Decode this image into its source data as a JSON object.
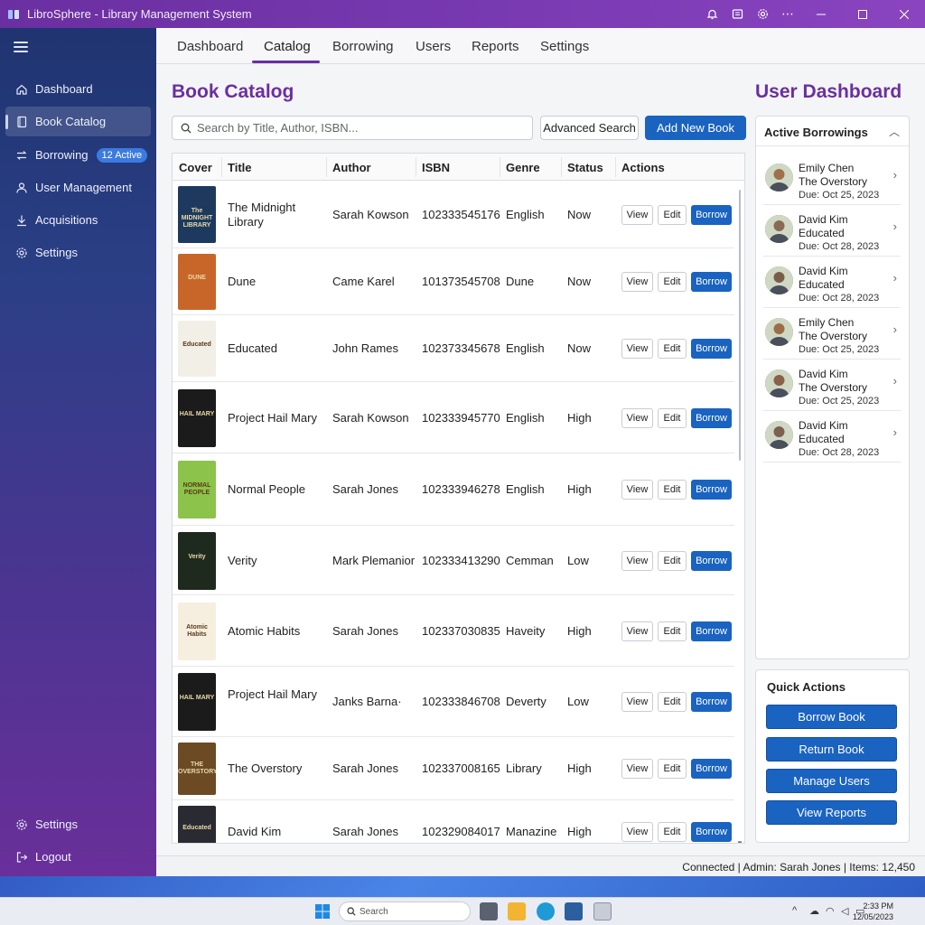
{
  "window": {
    "title": "LibroSphere - Library Management System",
    "status_bar": "Connected | Admin: Sarah Jones | Items: 12,450"
  },
  "sidebar": {
    "items": [
      {
        "label": "Dashboard",
        "icon": "home-icon"
      },
      {
        "label": "Book Catalog",
        "icon": "book-icon",
        "active": true
      },
      {
        "label": "Borrowing",
        "icon": "swap-icon",
        "badge": "12 Active"
      },
      {
        "label": "User Management",
        "icon": "users-icon"
      },
      {
        "label": "Acquisitions",
        "icon": "download-icon"
      },
      {
        "label": "Settings",
        "icon": "gear-icon"
      }
    ],
    "bottom": [
      {
        "label": "Settings",
        "icon": "gear-icon"
      },
      {
        "label": "Logout",
        "icon": "logout-icon"
      }
    ]
  },
  "tabs": [
    "Dashboard",
    "Catalog",
    "Borrowing",
    "Users",
    "Reports",
    "Settings"
  ],
  "active_tab": "Catalog",
  "catalog": {
    "title": "Book Catalog",
    "search_placeholder": "Search by Title, Author, ISBN...",
    "advanced_search": "Advanced Search",
    "add_new": "Add New Book",
    "columns": [
      "Cover",
      "Title",
      "Author",
      "ISBN",
      "Genre",
      "Status",
      "Actions"
    ],
    "view_label": "View",
    "edit_label": "Edit",
    "borrow_label": "Borrow",
    "rows": [
      {
        "title": "The Midnight Library",
        "author": "Sarah Kowson",
        "isbn": "102333545176",
        "genre": "English",
        "status": "Now",
        "cover_text": "The MIDNIGHT LIBRARY",
        "cover_bg": "#1d3a5e"
      },
      {
        "title": "Dune",
        "author": "Came Karel",
        "isbn": "101373545708",
        "genre": "Dune",
        "status": "Now",
        "cover_text": "DUNE",
        "cover_bg": "#c8662a"
      },
      {
        "title": "Educated",
        "author": "John Rames",
        "isbn": "102373345678",
        "genre": "English",
        "status": "Now",
        "cover_text": "Educated",
        "cover_bg": "#f2efe6"
      },
      {
        "title": "Project Hail Mary",
        "author": "Sarah Kowson",
        "isbn": "102333945770",
        "genre": "English",
        "status": "High",
        "cover_text": "HAIL MARY",
        "cover_bg": "#1b1b1b"
      },
      {
        "title": "Normal People",
        "author": "Sarah Jones",
        "isbn": "102333946278",
        "genre": "English",
        "status": "High",
        "cover_text": "NORMAL PEOPLE",
        "cover_bg": "#8cc34a"
      },
      {
        "title": "Verity",
        "author": "Mark Plemanior",
        "isbn": "102333413290",
        "genre": "Cemman",
        "status": "Low",
        "cover_text": "Verity",
        "cover_bg": "#1f2a1f"
      },
      {
        "title": "Atomic Habits",
        "author": "Sarah Jones",
        "isbn": "102337030835",
        "genre": "Haveity",
        "status": "High",
        "cover_text": "Atomic Habits",
        "cover_bg": "#f6efe0"
      },
      {
        "title": "Project Hail Mary",
        "author": "Janks Barna·",
        "isbn": "102333846708",
        "genre": "Deverty",
        "status": "Low",
        "cover_text": "HAIL MARY",
        "cover_bg": "#1b1b1b"
      },
      {
        "title": "The Overstory",
        "author": "Sarah Jones",
        "isbn": "102337008165",
        "genre": "Library",
        "status": "High",
        "cover_text": "THE OVERSTORY",
        "cover_bg": "#6b4a24"
      },
      {
        "title": "David Kim",
        "author": "Sarah Jones",
        "isbn": "102329084017",
        "genre": "Manazine",
        "status": "High",
        "cover_text": "Educated",
        "cover_bg": "#2a2a33"
      }
    ]
  },
  "user_dashboard": {
    "title": "User Dashboard",
    "active_borrowings_title": "Active Borrowings",
    "borrowings": [
      {
        "name": "Emily Chen",
        "book": "The Overstory",
        "due": "Due: Oct 25, 2023",
        "avatar_color": "#a0704a"
      },
      {
        "name": "David Kim",
        "book": "Educated",
        "due": "Due: Oct 28, 2023",
        "avatar_color": "#8a6a52"
      },
      {
        "name": "David Kim",
        "book": "Educated",
        "due": "Due: Oct 28, 2023",
        "avatar_color": "#7a5d48"
      },
      {
        "name": "Emily Chen",
        "book": "The Overstory",
        "due": "Due: Oct 25, 2023",
        "avatar_color": "#9c6e48"
      },
      {
        "name": "David Kim",
        "book": "The Overstory",
        "due": "Due: Oct 25, 2023",
        "avatar_color": "#8a6048"
      },
      {
        "name": "David Kim",
        "book": "Educated",
        "due": "Due: Oct 28, 2023",
        "avatar_color": "#7d6050"
      }
    ],
    "quick_actions_title": "Quick Actions",
    "quick_actions": [
      "Borrow Book",
      "Return Book",
      "Manage Users",
      "View Reports"
    ]
  },
  "taskbar": {
    "search_label": "Search",
    "time": "2:33 PM",
    "date": "12/05/2023"
  }
}
